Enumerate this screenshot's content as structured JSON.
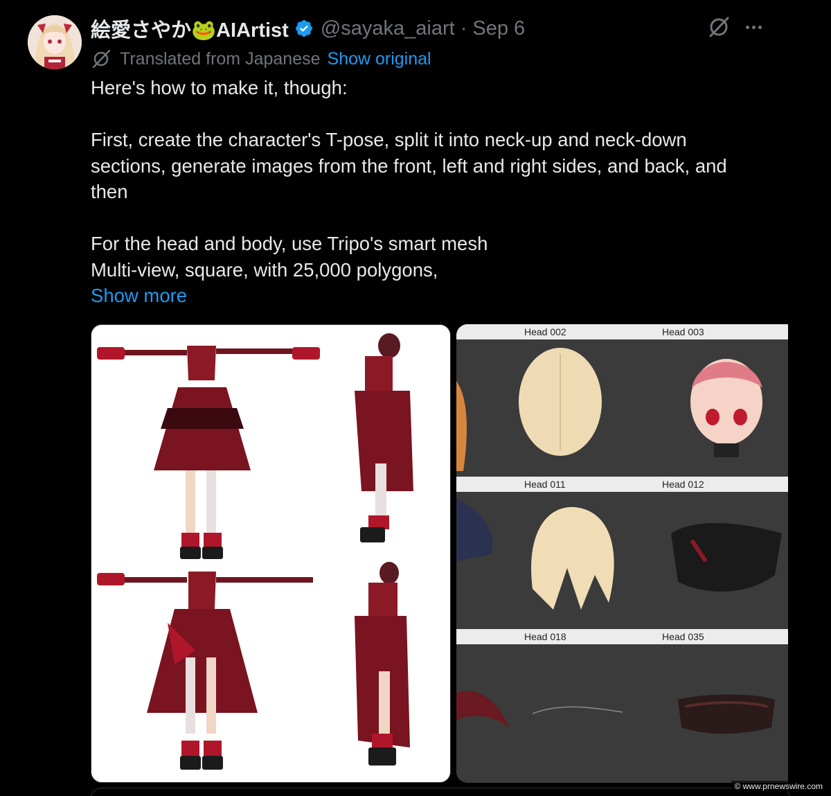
{
  "tweet": {
    "display_name": "絵愛さやか🐸AIArtist",
    "handle": "@sayaka_aiart",
    "separator": "·",
    "date": "Sep 6",
    "translated_label": "Translated from Japanese",
    "show_original": "Show original",
    "lines": [
      "Here's how to make it, though:",
      "",
      "First, create the character's T-pose, split it into neck-up and neck-down",
      "sections, generate images from the front, left and right sides, and back, and",
      "then",
      "",
      "For the head and body, use Tripo's smart mesh",
      "Multi-view, square, with 25,000 polygons,"
    ],
    "show_more": "Show more"
  },
  "media": {
    "right_labels": [
      [
        "Head 002",
        "Head 003"
      ],
      [
        "Head 011",
        "Head 012"
      ],
      [
        "Head 018",
        "Head 035"
      ]
    ]
  },
  "icons": {
    "verified": "verified-badge-icon",
    "grok": "grok-icon",
    "more": "more-options-icon",
    "translate": "translate-icon"
  },
  "colors": {
    "background": "#000000",
    "text": "#e7e9ea",
    "muted": "#71767b",
    "link": "#1d9bf0",
    "verified": "#1d9bf0"
  },
  "watermark": "© www.prnewswire.com"
}
